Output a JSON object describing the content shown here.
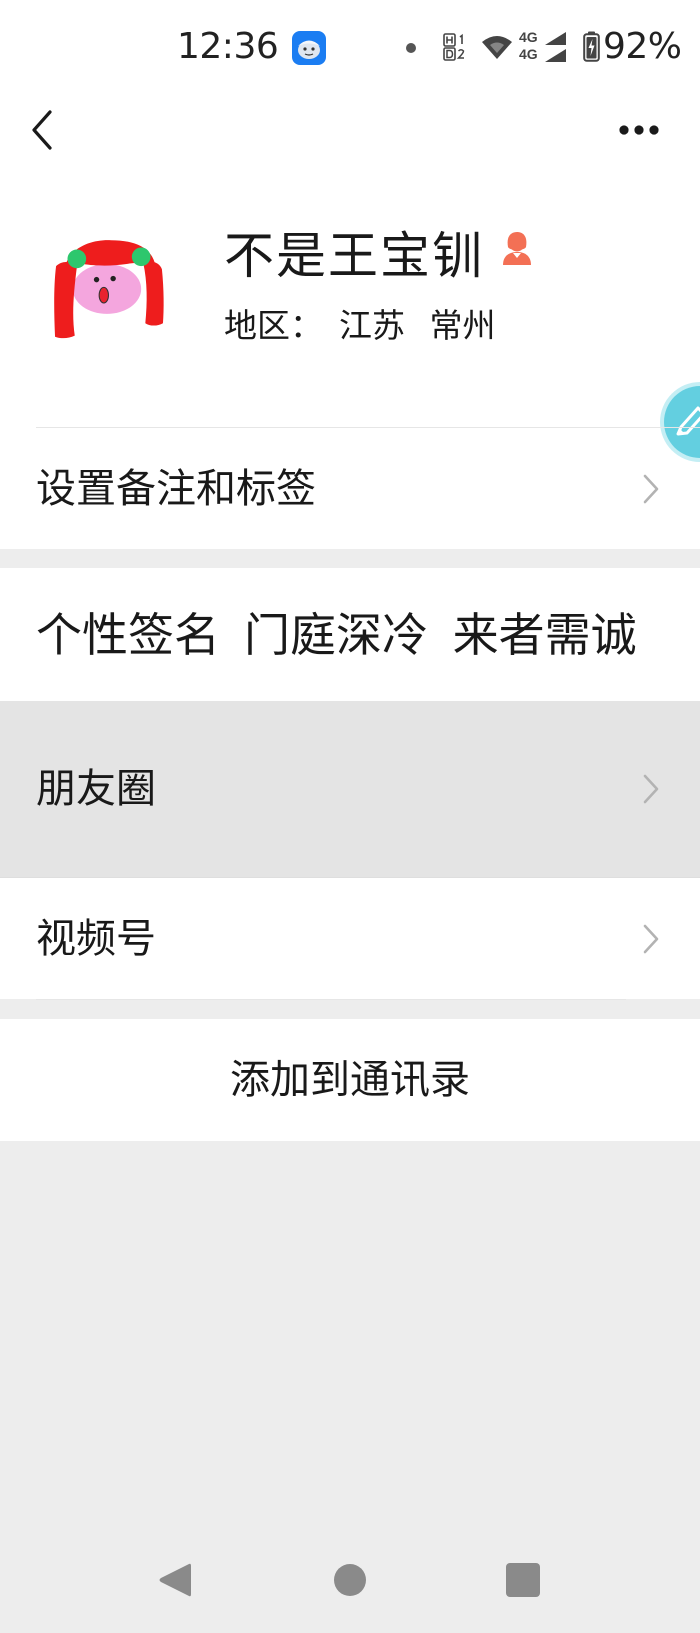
{
  "status_bar": {
    "time": "12:36",
    "sim1_network": "4G",
    "sim2_network": "4G",
    "battery": "92%",
    "icons": [
      "notification-app-icon",
      "notification-dot-icon",
      "hd-icon",
      "wifi-icon",
      "signal-icon",
      "battery-charging-icon"
    ]
  },
  "top_bar": {
    "back_icon": "chevron-left-icon",
    "more_icon": "more-dots-icon"
  },
  "profile": {
    "name": "不是王宝钏",
    "gender_icon": "female-icon",
    "region_label": "地区：",
    "region_value": "江苏 常州"
  },
  "edit_fab": {
    "icon": "pencil-icon"
  },
  "menu": {
    "remark_tags": "设置备注和标签",
    "signature_label": "个性签名",
    "signature_value": "门庭深冷 来者需诚",
    "moments": "朋友圈",
    "channels": "视频号",
    "add_contact": "添加到通讯录"
  },
  "system_nav": {
    "back_icon": "nav-back-triangle-icon",
    "home_icon": "nav-home-circle-icon",
    "recents_icon": "nav-recents-square-icon"
  },
  "colors": {
    "background": "#ededed",
    "card": "#ffffff",
    "pressed_row": "#e4e4e4",
    "text": "#191919",
    "chevron": "#b3b3b3",
    "fab": "#63cfe0",
    "female_icon": "#f37055",
    "app_icon": "#1b7df2"
  }
}
